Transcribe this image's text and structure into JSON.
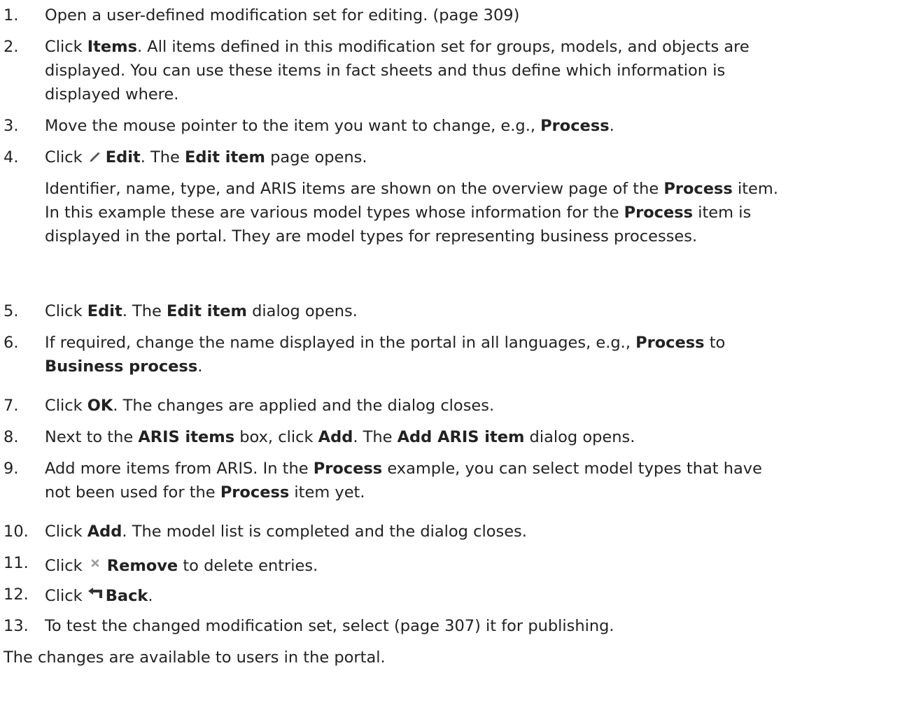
{
  "steps": [
    {
      "number": "1.",
      "text": "Open a user-defined modification set for editing. (page 309)"
    },
    {
      "number": "2.",
      "prefix": "Click ",
      "bold1": "Items",
      "rest_line1": ". All items defined in this modification set for groups, models, and objects are",
      "line2": "displayed. You can use these items in fact sheets and thus define which information is",
      "line3": "displayed where."
    },
    {
      "number": "3.",
      "text": "Move the mouse pointer to the item you want to change, e.g., ",
      "bold": "Process",
      "end": "."
    },
    {
      "number": "4.",
      "prefix": "Click ",
      "icon": "pencil-icon",
      "bold1": "Edit",
      "mid": ". The ",
      "bold2": "Edit item",
      "end": " page opens.",
      "para_l1_a": "Identifier, name, type, and ARIS items are shown on the overview page of the ",
      "para_l1_b": "Process",
      "para_l1_c": " item.",
      "para_l2_a": "In this example these are various model types whose information for the ",
      "para_l2_b": "Process",
      "para_l2_c": " item is",
      "para_l3": "displayed in the portal. They are model types for representing business processes."
    },
    {
      "number": "5.",
      "prefix": "Click ",
      "bold1": "Edit",
      "mid": ". The ",
      "bold2": "Edit item",
      "end": " dialog opens."
    },
    {
      "number": "6.",
      "text": "If required, change the name displayed in the portal in all languages, e.g., ",
      "bold1": "Process",
      "mid": " to",
      "bold2": "Business process",
      "end": "."
    },
    {
      "number": "7.",
      "prefix": "Click ",
      "bold": "OK",
      "end": ". The changes are applied and the dialog closes."
    },
    {
      "number": "8.",
      "prefix": "Next to the ",
      "bold1": "ARIS items",
      "mid1": " box, click ",
      "bold2": "Add",
      "mid2": ". The ",
      "bold3": "Add ARIS item",
      "end": " dialog opens."
    },
    {
      "number": "9.",
      "l1_a": "Add more items from ARIS. In the ",
      "l1_b": "Process",
      "l1_c": " example, you can select model types that have",
      "l2_a": "not been used for the ",
      "l2_b": "Process",
      "l2_c": " item yet."
    },
    {
      "number": "10.",
      "prefix": "Click ",
      "bold": "Add",
      "end": ". The model list is completed and the dialog closes."
    },
    {
      "number": "11.",
      "prefix": "Click ",
      "icon": "remove-x-icon",
      "bold": "Remove",
      "end": " to delete entries."
    },
    {
      "number": "12.",
      "prefix": "Click ",
      "icon": "back-arrow-icon",
      "bold": "Back",
      "end": "."
    },
    {
      "number": "13.",
      "text": "To test the changed modification set, select (page 307) it for publishing."
    }
  ],
  "outro": "The changes are available to users in the portal.",
  "colors": {
    "text": "#222222",
    "icon": "#555555",
    "icon_light": "#9a9a9a"
  }
}
